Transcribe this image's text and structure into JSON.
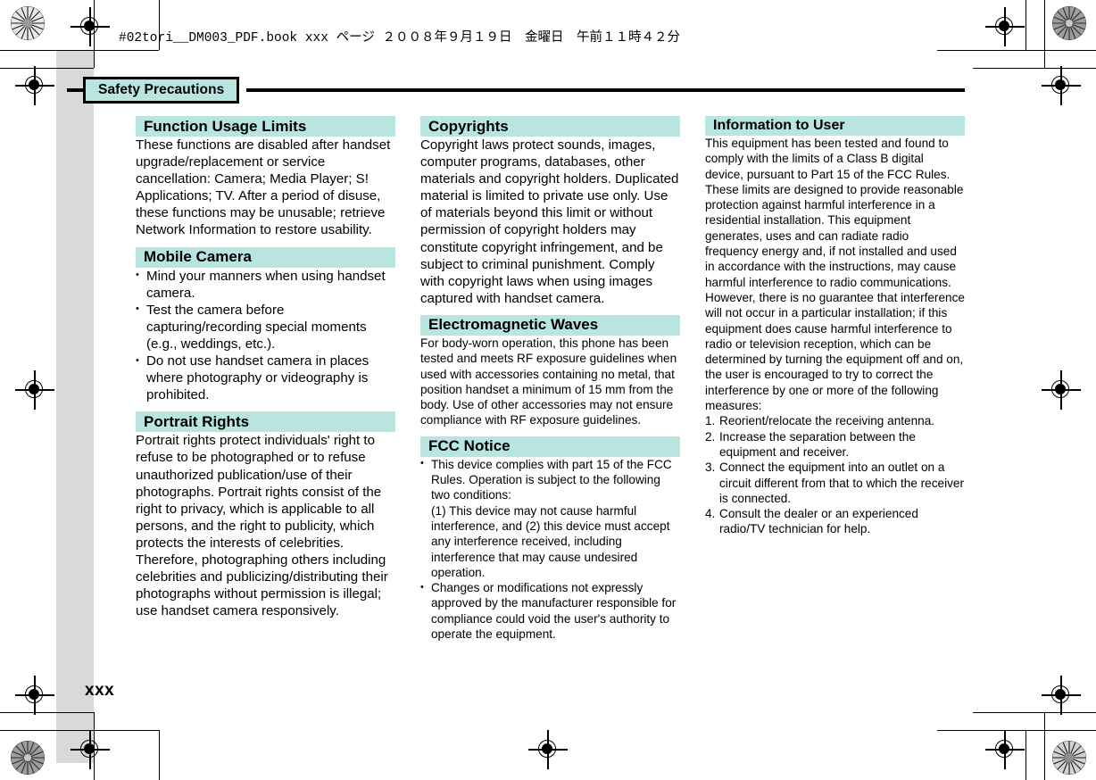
{
  "running_head": "#02tori__DM003_PDF.book  xxx ページ  ２００８年９月１９日　金曜日　午前１１時４２分",
  "chapter_tab": "Safety Precautions",
  "folio": "xxx",
  "colors": {
    "accent": "#b9e5e1",
    "rule": "#000000",
    "bleed": "#d9d9d9"
  },
  "columns": [
    {
      "id": "column-1",
      "sections": [
        {
          "heading": "Function Usage Limits",
          "paragraphs": [
            "These functions are disabled after handset upgrade/replacement or service cancellation: Camera; Media Player; S! Applications; TV. After a period of disuse, these functions may be unusable; retrieve Network Information to restore usability."
          ]
        },
        {
          "heading": "Mobile Camera",
          "bullets": [
            "Mind your manners when using handset camera.",
            "Test the camera before capturing/recording special moments (e.g., weddings, etc.).",
            "Do not use handset camera in places where photography or videography is prohibited."
          ]
        },
        {
          "heading": "Portrait Rights",
          "paragraphs": [
            "Portrait rights protect individuals' right to refuse to be photographed or to refuse unauthorized publication/use of their photographs. Portrait rights consist of the right to privacy, which is applicable to all persons, and the right to publicity, which protects the interests of celebrities. Therefore, photographing others including celebrities and publicizing/distributing their photographs without permission is illegal; use handset camera responsively."
          ]
        }
      ]
    },
    {
      "id": "column-2",
      "sections": [
        {
          "heading": "Copyrights",
          "paragraphs": [
            "Copyright laws protect sounds, images, computer programs, databases, other materials and copyright holders. Duplicated material is limited to private use only. Use of materials beyond this limit or without permission of copyright holders may constitute copyright infringement, and be subject to criminal punishment. Comply with copyright laws when using images captured with handset camera."
          ]
        },
        {
          "heading": "Electromagnetic Waves",
          "paragraphs": [
            "For body-worn operation, this phone has been tested and meets RF exposure guidelines when used with accessories containing no metal, that position handset a minimum of 15 mm from the body. Use of other accessories may not ensure compliance with RF exposure guidelines."
          ]
        },
        {
          "heading": "FCC Notice",
          "bullets": [
            "This device complies with part 15 of the FCC Rules. Operation is subject to the following two conditions:",
            "Changes or modifications not expressly approved by the manufacturer responsible for compliance could void the user's authority to operate the equipment."
          ],
          "bullet_1_subtext": "(1) This device may not cause harmful interference, and (2) this device must accept any interference received, including interference that may cause undesired operation."
        }
      ]
    },
    {
      "id": "column-3",
      "sections": [
        {
          "heading": "Information to User",
          "paragraphs": [
            "This equipment has been tested and found to comply with the limits of a Class B digital device, pursuant to Part 15 of the FCC Rules. These limits are designed to provide reasonable protection against harmful interference in a residential installation. This equipment generates, uses and can radiate radio frequency energy and, if not installed and used in accordance with the instructions, may cause harmful interference to radio communications. However, there is no guarantee that interference will not occur in a particular installation; if this equipment does cause harmful interference to radio or television reception, which can be determined by turning the equipment off and on, the user is encouraged to try to correct the interference by one or more of the following measures:"
          ],
          "numbered": [
            {
              "num": "1.",
              "text": "Reorient/relocate the receiving antenna."
            },
            {
              "num": "2.",
              "text": "Increase the separation between the equipment and receiver."
            },
            {
              "num": "3.",
              "text": "Connect the equipment into an outlet on a circuit different from that to which the receiver is connected."
            },
            {
              "num": "4.",
              "text": "Consult the dealer or an experienced radio/TV technician for help."
            }
          ]
        }
      ]
    }
  ]
}
